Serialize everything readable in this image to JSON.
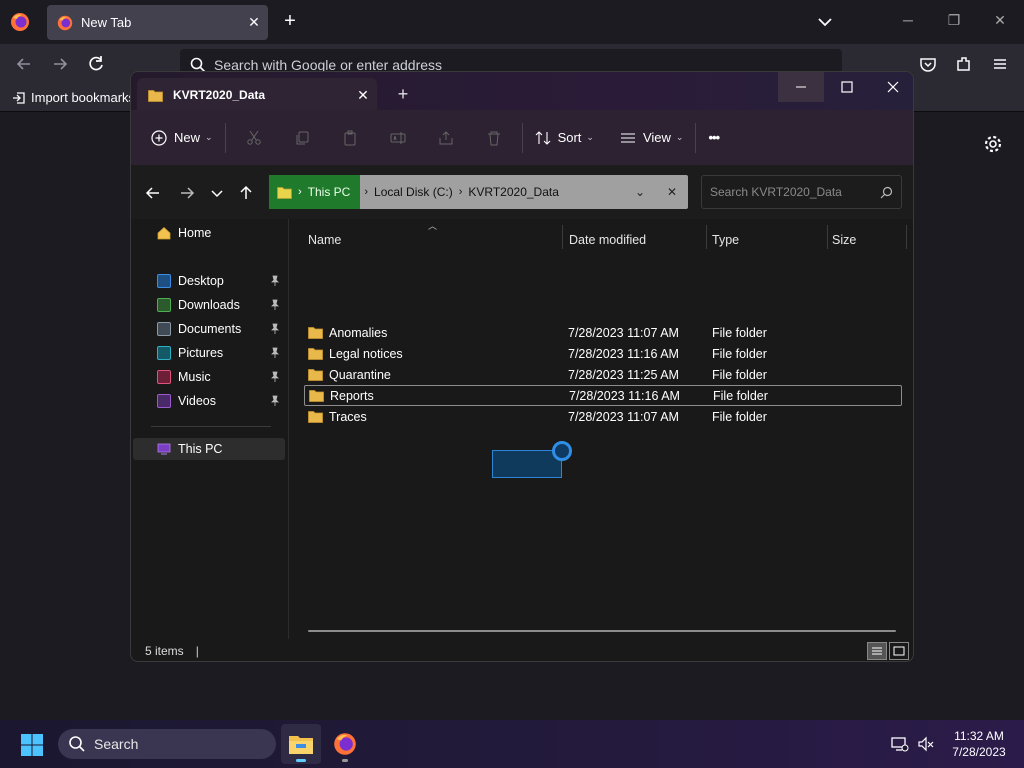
{
  "firefox": {
    "tab_title": "New Tab",
    "url_placeholder": "Search with Google or enter address",
    "import_bookmarks": "Import bookmarks"
  },
  "explorer": {
    "tab_title": "KVRT2020_Data",
    "toolbar": {
      "new_label": "New",
      "sort_label": "Sort",
      "view_label": "View",
      "more_label": "•••"
    },
    "breadcrumb": [
      "This PC",
      "Local Disk (C:)",
      "KVRT2020_Data"
    ],
    "search_placeholder": "Search KVRT2020_Data",
    "nav": {
      "home": "Home",
      "quick": [
        {
          "label": "Desktop",
          "color": "#3b8ee8"
        },
        {
          "label": "Downloads",
          "color": "#4caf50"
        },
        {
          "label": "Documents",
          "color": "#8a9aa8"
        },
        {
          "label": "Pictures",
          "color": "#2bb0c4"
        },
        {
          "label": "Music",
          "color": "#e0527a"
        },
        {
          "label": "Videos",
          "color": "#9b59d0"
        }
      ],
      "this_pc": "This PC"
    },
    "columns": {
      "name": "Name",
      "date": "Date modified",
      "type": "Type",
      "size": "Size"
    },
    "files": [
      {
        "name": "Anomalies",
        "date": "7/28/2023 11:07 AM",
        "type": "File folder"
      },
      {
        "name": "Legal notices",
        "date": "7/28/2023 11:16 AM",
        "type": "File folder"
      },
      {
        "name": "Quarantine",
        "date": "7/28/2023 11:25 AM",
        "type": "File folder"
      },
      {
        "name": "Reports",
        "date": "7/28/2023 11:16 AM",
        "type": "File folder"
      },
      {
        "name": "Traces",
        "date": "7/28/2023 11:07 AM",
        "type": "File folder"
      }
    ],
    "status": {
      "count": "5 items",
      "sep": "|"
    }
  },
  "taskbar": {
    "search_label": "Search",
    "time": "11:32 AM",
    "date": "7/28/2023"
  },
  "colors": {
    "folder": "#e8b84a",
    "accent": "#60cdff",
    "breadcrumb_head": "#1f7a2c"
  }
}
